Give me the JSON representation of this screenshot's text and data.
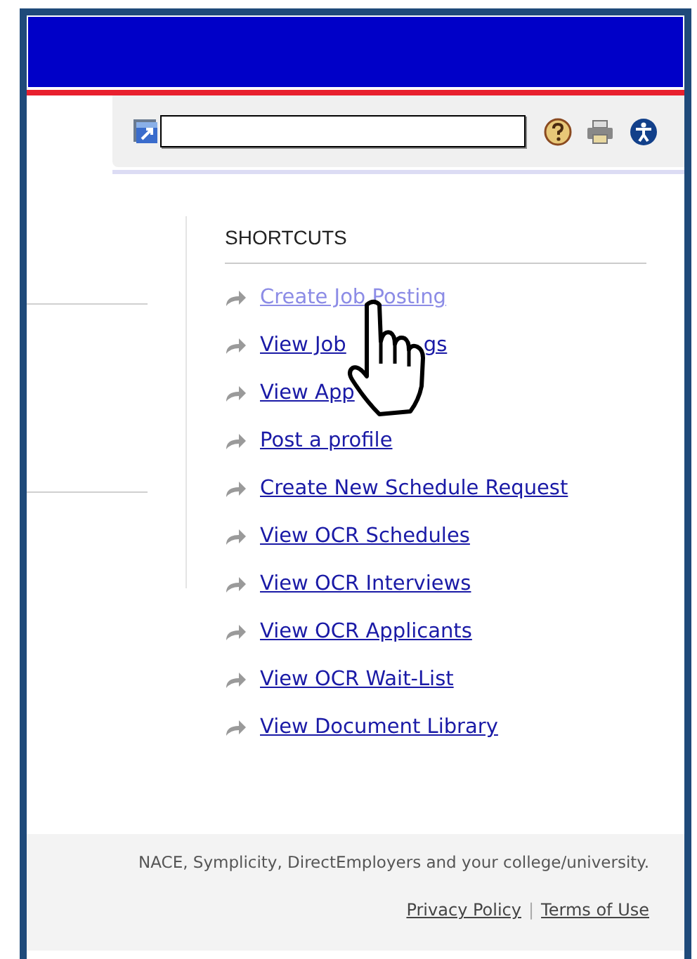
{
  "shortcuts": {
    "title": "SHORTCUTS",
    "links": [
      {
        "label": "Create Job Posting",
        "hovered": true
      },
      {
        "label": "View Job",
        "tail": "gs",
        "hovered": false
      },
      {
        "label": "View App",
        "hovered": false
      },
      {
        "label": "Post a profile",
        "hovered": false
      },
      {
        "label": "Create New Schedule Request",
        "hovered": false
      },
      {
        "label": "View OCR Schedules",
        "hovered": false
      },
      {
        "label": "View OCR Interviews",
        "hovered": false
      },
      {
        "label": "View OCR Applicants",
        "hovered": false
      },
      {
        "label": "View OCR Wait-List",
        "hovered": false
      },
      {
        "label": "View Document Library",
        "hovered": false
      }
    ]
  },
  "footer": {
    "notice": "NACE, Symplicity, DirectEmployers and your college/university.",
    "links": [
      "Privacy Policy",
      "Terms of Use"
    ],
    "separator": "|"
  }
}
